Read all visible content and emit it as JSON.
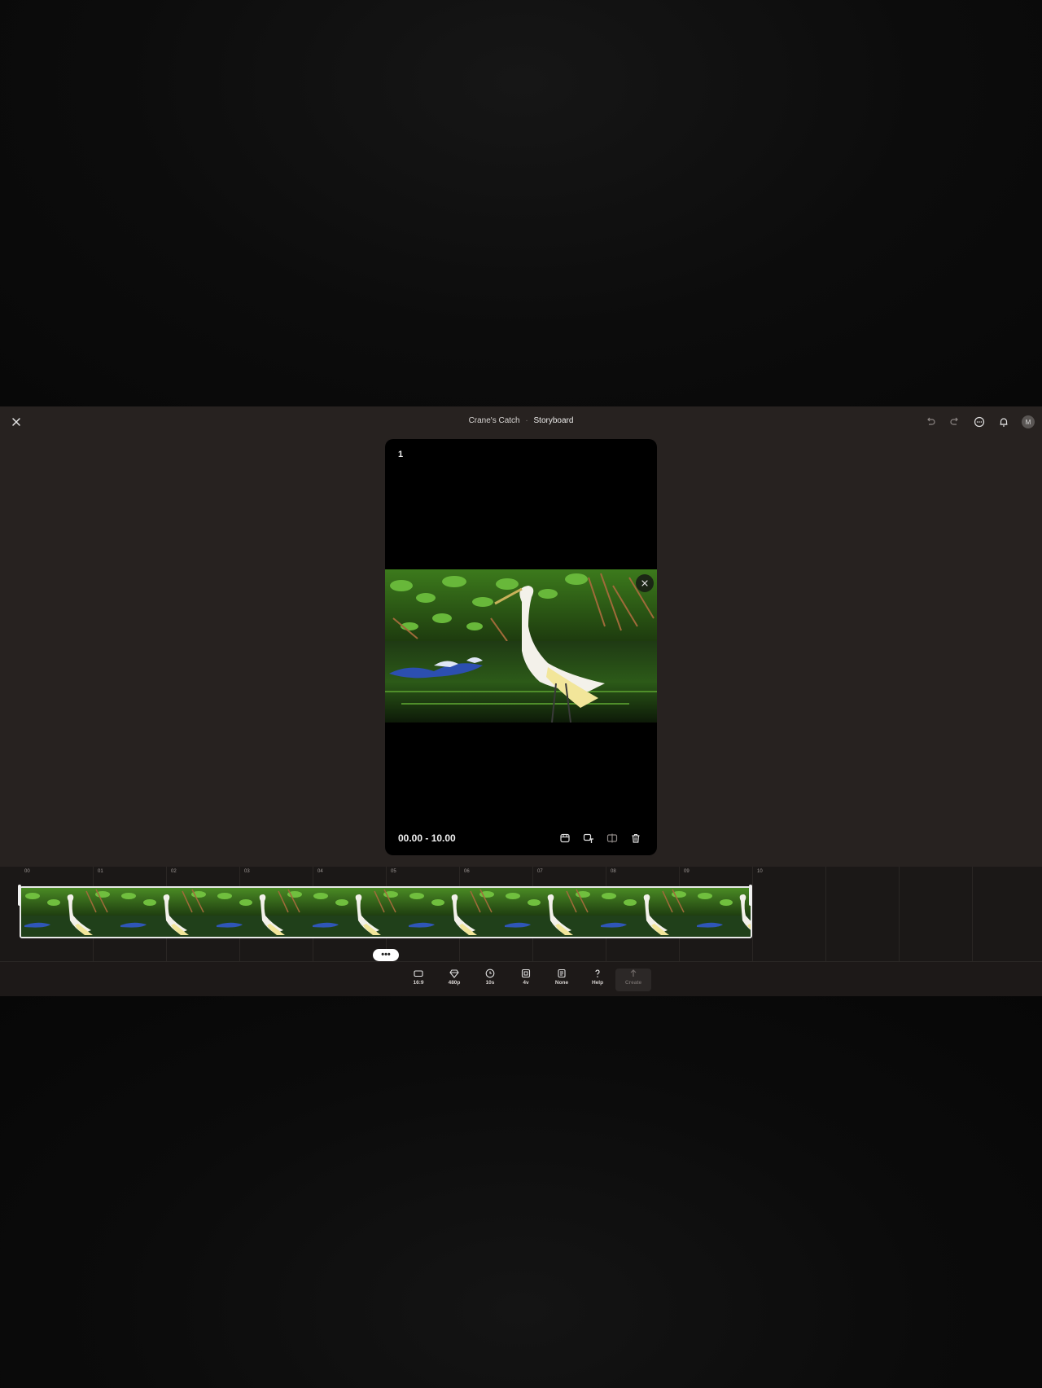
{
  "header": {
    "project_name": "Crane's Catch",
    "separator": "·",
    "view_name": "Storyboard",
    "avatar_initial": "M"
  },
  "card": {
    "index": "1",
    "time_range": "00.00 - 10.00"
  },
  "timeline": {
    "ticks": [
      "00",
      "01",
      "02",
      "03",
      "04",
      "05",
      "06",
      "07",
      "08",
      "09",
      "10"
    ],
    "more_label": "•••"
  },
  "toolbar": {
    "items": [
      {
        "label": "16:9",
        "icon": "aspect-ratio-icon"
      },
      {
        "label": "480p",
        "icon": "diamond-icon"
      },
      {
        "label": "10s",
        "icon": "clock-icon"
      },
      {
        "label": "4v",
        "icon": "variations-icon"
      },
      {
        "label": "None",
        "icon": "preset-icon"
      },
      {
        "label": "Help",
        "icon": "help-icon"
      },
      {
        "label": "Create",
        "icon": "upload-arrow-icon"
      }
    ]
  },
  "colors": {
    "app_bg": "#272220",
    "timeline_bg": "#1b1817",
    "card_bg": "#000000"
  }
}
